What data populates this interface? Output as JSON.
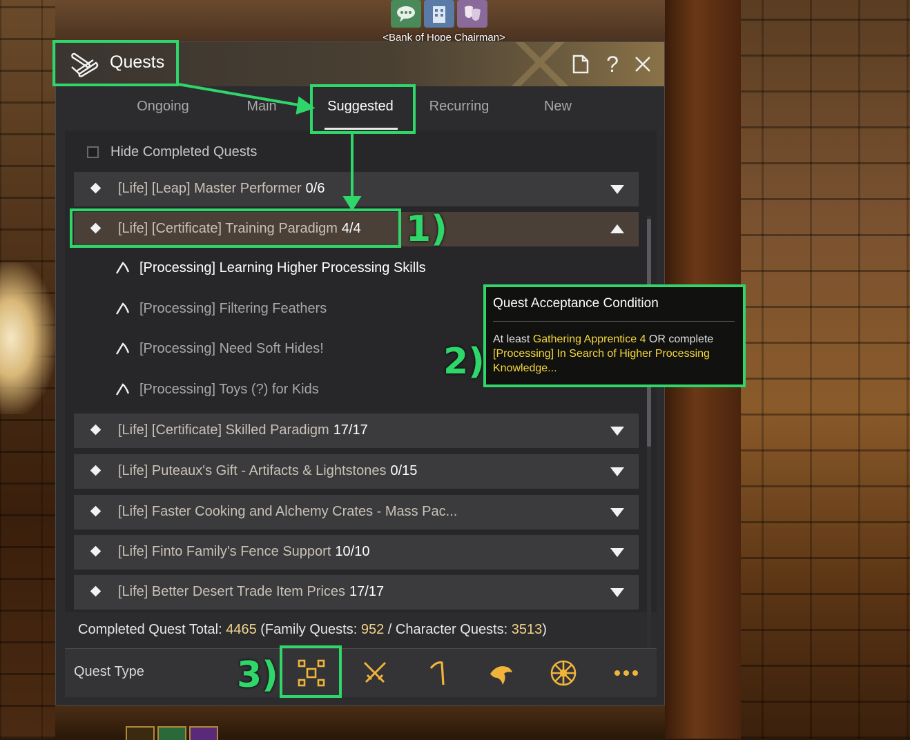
{
  "scene": {
    "npc_name": "<Bank of Hope Chairman>",
    "top_icons": [
      "chat-bubble-icon",
      "building-icon",
      "masks-icon"
    ]
  },
  "window": {
    "title": "Quests",
    "header_buttons": [
      "document-icon",
      "help-icon",
      "close-icon"
    ],
    "help_glyph": "?"
  },
  "tabs": [
    {
      "label": "Ongoing",
      "active": false
    },
    {
      "label": "Main",
      "active": false
    },
    {
      "label": "Suggested",
      "active": true
    },
    {
      "label": "Recurring",
      "active": false
    },
    {
      "label": "New",
      "active": false
    }
  ],
  "hide_completed": {
    "label": "Hide Completed Quests",
    "checked": false
  },
  "quests": [
    {
      "title": "[Life] [Leap] Master Performer",
      "count": "0/6",
      "expanded": false
    },
    {
      "title": "[Life] [Certificate] Training Paradigm",
      "count": "4/4",
      "expanded": true
    },
    {
      "title": "[Life] [Certificate] Skilled Paradigm",
      "count": "17/17",
      "expanded": false
    },
    {
      "title": "[Life] Puteaux's Gift - Artifacts & Lightstones",
      "count": "0/15",
      "expanded": false
    },
    {
      "title": "[Life] Faster Cooking and Alchemy Crates - Mass Pac...",
      "count": "",
      "expanded": false
    },
    {
      "title": "[Life] Finto Family's Fence Support",
      "count": "10/10",
      "expanded": false
    },
    {
      "title": "[Life] Better Desert Trade Item Prices",
      "count": "17/17",
      "expanded": false
    }
  ],
  "subquests": [
    {
      "label": "[Processing] Learning Higher Processing Skills",
      "available": true
    },
    {
      "label": "[Processing] Filtering Feathers",
      "available": false
    },
    {
      "label": "[Processing] Need Soft Hides!",
      "available": false
    },
    {
      "label": "[Processing] Toys (?) for Kids",
      "available": false
    }
  ],
  "totals": {
    "prefix": "Completed Quest Total: ",
    "total": "4465",
    "family_label": " (Family Quests: ",
    "family": "952",
    "sep": " / Character Quests: ",
    "character": "3513",
    "close": ")"
  },
  "quest_type": {
    "label": "Quest Type",
    "icons": [
      "all-types-icon",
      "combat-swords-icon",
      "life-pickaxe-icon",
      "fishing-icon",
      "sailing-wheel-icon",
      "more-icon"
    ]
  },
  "tooltip": {
    "title": "Quest Acceptance Condition",
    "p1": "At least ",
    "req1": "Gathering Apprentice 4",
    "p2": " OR complete ",
    "req2": "[Processing] In Search of Higher Processing Knowledge..."
  },
  "annotations": {
    "n1": "1)",
    "n2": "2)",
    "n3": "3)",
    "color": "#2fd66a"
  }
}
